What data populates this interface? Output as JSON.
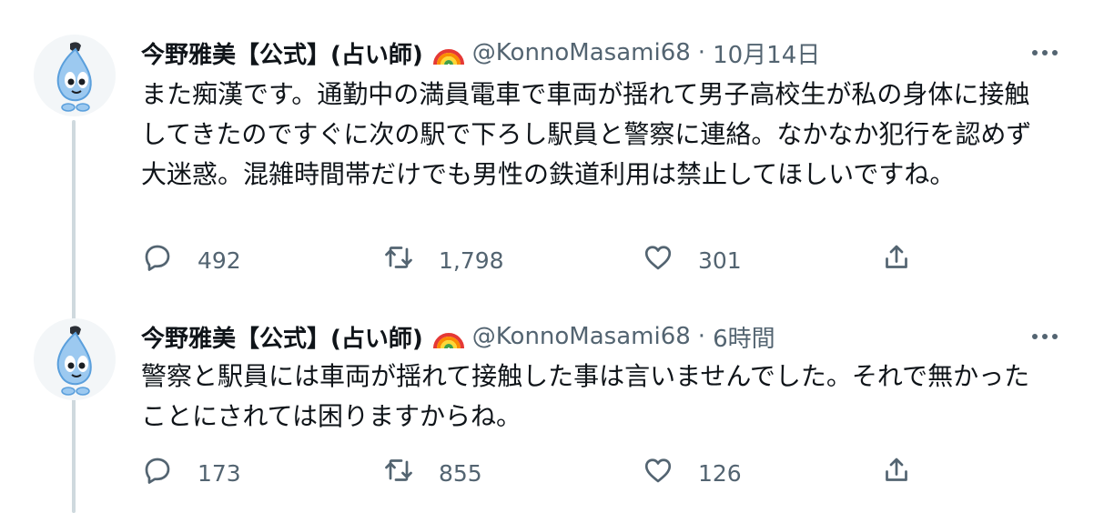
{
  "tweets": [
    {
      "display_name": "今野雅美【公式】(占い師)",
      "handle": "@KonnoMasami68",
      "separator": "·",
      "timestamp": "10月14日",
      "text": "また痴漢です。通勤中の満員電車で車両が揺れて男子高校生が私の身体に接触してきたのですぐに次の駅で下ろし駅員と警察に連絡。なかなか犯行を認めず大迷惑。混雑時間帯だけでも男性の鉄道利用は禁止してほしいですね。",
      "replies": "492",
      "retweets": "1,798",
      "likes": "301"
    },
    {
      "display_name": "今野雅美【公式】(占い師)",
      "handle": "@KonnoMasami68",
      "separator": "·",
      "timestamp": "6時間",
      "text": "警察と駅員には車両が揺れて接触した事は言いませんでした。それで無かったことにされては困りますからね。",
      "replies": "173",
      "retweets": "855",
      "likes": "126"
    }
  ],
  "icons": {
    "badge": "rainbow-icon",
    "more": "more-dots-icon",
    "reply": "reply-icon",
    "retweet": "retweet-icon",
    "like": "heart-icon",
    "share": "share-icon"
  },
  "colors": {
    "text": "#0f1419",
    "muted": "#536471",
    "thread_line": "#cfd9de"
  }
}
